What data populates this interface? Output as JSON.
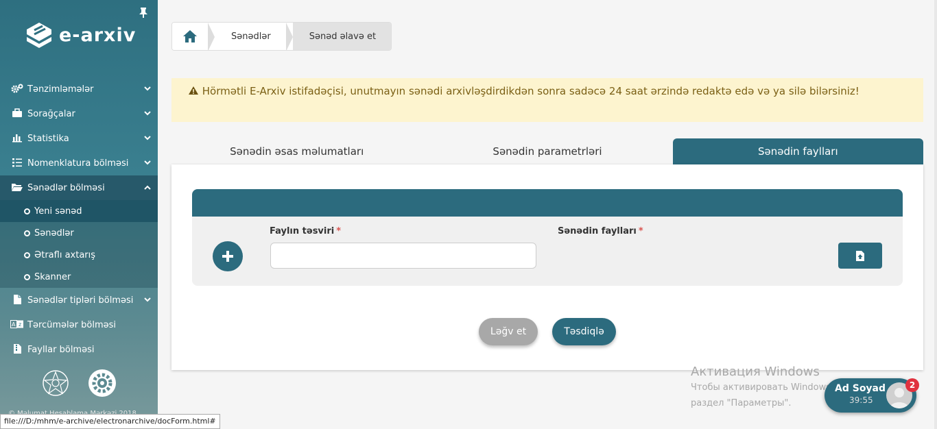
{
  "sidebar": {
    "logo_text": "e-arxiv",
    "menu": [
      {
        "label": "Tənzimləmələr",
        "icon": "cogs-icon"
      },
      {
        "label": "Sorağçalar",
        "icon": "briefcase-icon"
      },
      {
        "label": "Statistika",
        "icon": "bar-chart-icon"
      },
      {
        "label": "Nomenklatura bölməsi",
        "icon": "list-icon"
      }
    ],
    "active_section": {
      "label": "Sənədlər bölməsi",
      "icon": "folder-open-icon"
    },
    "submenu": [
      {
        "label": "Yeni sənəd"
      },
      {
        "label": "Sənədlər"
      },
      {
        "label": "Ətraflı axtarış"
      },
      {
        "label": "Skanner"
      }
    ],
    "menu_after": [
      {
        "label": "Sənədlər tipləri bölməsi",
        "icon": "file-icon"
      },
      {
        "label": "Tərcümələr bölməsi",
        "icon": "translate-icon"
      },
      {
        "label": "Fayllar bölməsi",
        "icon": "file-zip-icon"
      }
    ],
    "copyright": "© Məlumat Hesablama Mərkəzi 2018"
  },
  "breadcrumb": {
    "home_icon": "home-icon",
    "items": [
      "Sənədlər",
      "Sənəd əlavə et"
    ]
  },
  "alert": {
    "icon": "warning-icon",
    "text": "Hörmətli E-Arxiv istifadəçisi, unutmayın sənədi arxivləşdirdikdən sonra sadəcə 24 saat ərzində redaktə edə və ya silə bilərsiniz!"
  },
  "tabs": [
    {
      "label": "Sənədin əsas məlumatları",
      "active": false
    },
    {
      "label": "Sənədin parametrləri",
      "active": false
    },
    {
      "label": "Sənədin faylları",
      "active": true
    }
  ],
  "form": {
    "description_label": "Faylın təsviri",
    "files_label": "Sənədin faylları",
    "required_mark": "*",
    "description_value": "",
    "cancel_label": "Ləğv et",
    "confirm_label": "Təsdiqlə"
  },
  "watermark": {
    "title": "Активация Windows",
    "line1": "Чтобы активировать Windows, перейдите в",
    "line2": "раздел \"Параметры\"."
  },
  "user": {
    "name": "Ad Soyad",
    "time": "39:55",
    "badge": "2"
  },
  "statusbar": {
    "url": "file:///D:/mhm/e-archive/electronarchive/docForm.html#"
  },
  "colors": {
    "primary": "#2c6b7e",
    "alert_bg": "#fdf4cf",
    "badge": "#e0313e"
  }
}
